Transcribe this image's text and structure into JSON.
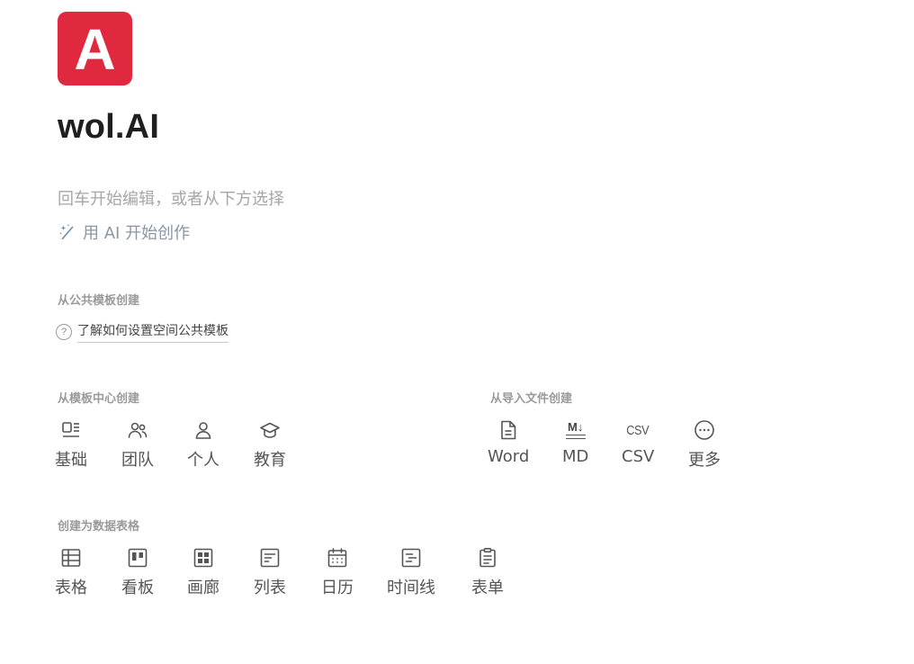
{
  "brand": {
    "logo_letter": "A",
    "title": "wol.AI",
    "logo_color": "#e0283f"
  },
  "hint": "回车开始编辑，或者从下方选择",
  "ai_start": {
    "label": "用 AI 开始创作",
    "icon": "magic-wand-icon"
  },
  "public_templates": {
    "heading": "从公共模板创建",
    "link": "了解如何设置空间公共模板",
    "link_icon": "question-circle-icon"
  },
  "template_center": {
    "heading": "从模板中心创建",
    "items": [
      {
        "label": "基础",
        "icon": "layout-icon"
      },
      {
        "label": "团队",
        "icon": "team-icon"
      },
      {
        "label": "个人",
        "icon": "person-icon"
      },
      {
        "label": "教育",
        "icon": "graduation-cap-icon"
      }
    ]
  },
  "import_files": {
    "heading": "从导入文件创建",
    "items": [
      {
        "label": "Word",
        "icon": "document-icon"
      },
      {
        "label": "MD",
        "icon": "markdown-icon",
        "icon_text": "M↓"
      },
      {
        "label": "CSV",
        "icon": "csv-icon",
        "icon_text": "CSV"
      },
      {
        "label": "更多",
        "icon": "more-circle-icon"
      }
    ]
  },
  "data_tables": {
    "heading": "创建为数据表格",
    "items": [
      {
        "label": "表格",
        "icon": "table-icon"
      },
      {
        "label": "看板",
        "icon": "kanban-icon"
      },
      {
        "label": "画廊",
        "icon": "gallery-icon"
      },
      {
        "label": "列表",
        "icon": "list-icon"
      },
      {
        "label": "日历",
        "icon": "calendar-icon"
      },
      {
        "label": "时间线",
        "icon": "timeline-icon"
      },
      {
        "label": "表单",
        "icon": "form-icon"
      }
    ]
  }
}
